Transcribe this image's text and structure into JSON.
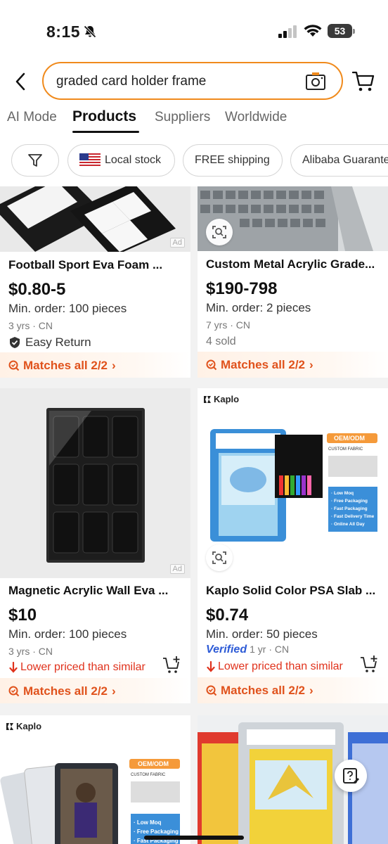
{
  "status_bar": {
    "time": "8:15",
    "battery": "53"
  },
  "search": {
    "query": "graded card holder frame"
  },
  "tabs": [
    {
      "label": "AI Mode"
    },
    {
      "label": "Products"
    },
    {
      "label": "Suppliers"
    },
    {
      "label": "Worldwide"
    }
  ],
  "filters": {
    "local_stock": "Local stock",
    "free_shipping": "FREE shipping",
    "guarantee": "Alibaba Guarantee"
  },
  "products": [
    {
      "title": "Football Sport Eva Foam ...",
      "price": "$0.80-5",
      "moq": "Min. order: 100 pieces",
      "meta": "3 yrs · CN",
      "extra": "Easy Return",
      "ad": "Ad",
      "matches": "Matches all 2/2"
    },
    {
      "title": "Custom Metal Acrylic Grade...",
      "price": "$190-798",
      "moq": "Min. order: 2 pieces",
      "meta": "7 yrs · CN",
      "sold": "4 sold",
      "matches": "Matches all 2/2"
    },
    {
      "title": "Magnetic Acrylic Wall Eva ...",
      "price": "$10",
      "moq": "Min. order: 100 pieces",
      "meta": "3 yrs · CN",
      "lower": "Lower priced than similar",
      "ad": "Ad",
      "matches": "Matches all 2/2"
    },
    {
      "title": "Kaplo Solid Color PSA Slab ...",
      "price": "$0.74",
      "moq": "Min. order: 50 pieces",
      "verified": "Verified",
      "meta": "1 yr · CN",
      "lower": "Lower priced than similar",
      "matches": "Matches all 2/2",
      "brand": "Kaplo",
      "image_texts": {
        "badge": "OEM/ODM",
        "fabric": "CUSTOM FABRIC",
        "features": [
          "· Low Moq",
          "· Free Packaging",
          "· Fast Packaging",
          "· Fast Delivery Time",
          "· Online All Day"
        ]
      }
    },
    {
      "brand": "Kaplo",
      "image_texts": {
        "badge": "OEM/ODM",
        "fabric": "CUSTOM FABRIC",
        "features": [
          "· Low Moq",
          "· Free Packaging",
          "· Fast Packaging"
        ]
      }
    },
    {}
  ],
  "colors": {
    "accent": "#f08a1c",
    "match": "#e0521c",
    "lower": "#e0321c",
    "verified": "#2d5bd6"
  }
}
